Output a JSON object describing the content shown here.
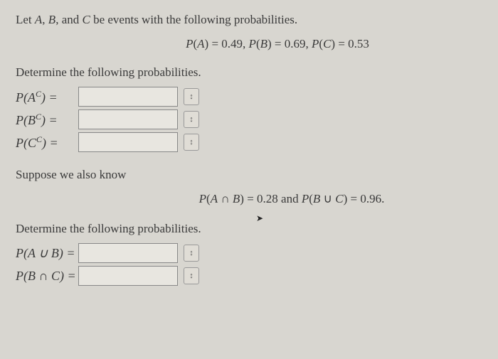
{
  "intro": "Let A, B, and C be events with the following probabilities.",
  "given": "P(A) = 0.49, P(B) = 0.69, P(C) = 0.53",
  "section1": "Determine the following probabilities.",
  "labels": {
    "PAc": "P(A",
    "PBc": "P(B",
    "PCc": "P(C",
    "sup": "C",
    "close": ") =",
    "PAuB": "P(A ∪ B) =",
    "PBnC": "P(B ∩ C) ="
  },
  "suppose": "Suppose we also know",
  "additional": "P(A ∩ B) = 0.28 and P(B ∪ C) = 0.96.",
  "section2": "Determine the following probabilities.",
  "chart_data": {
    "type": "table",
    "title": "Probability problem",
    "given": {
      "P_A": 0.49,
      "P_B": 0.69,
      "P_C": 0.53
    },
    "also_known": {
      "P_A_intersect_B": 0.28,
      "P_B_union_C": 0.96
    },
    "unknowns": [
      "P(A^C)",
      "P(B^C)",
      "P(C^C)",
      "P(A ∪ B)",
      "P(B ∩ C)"
    ]
  }
}
